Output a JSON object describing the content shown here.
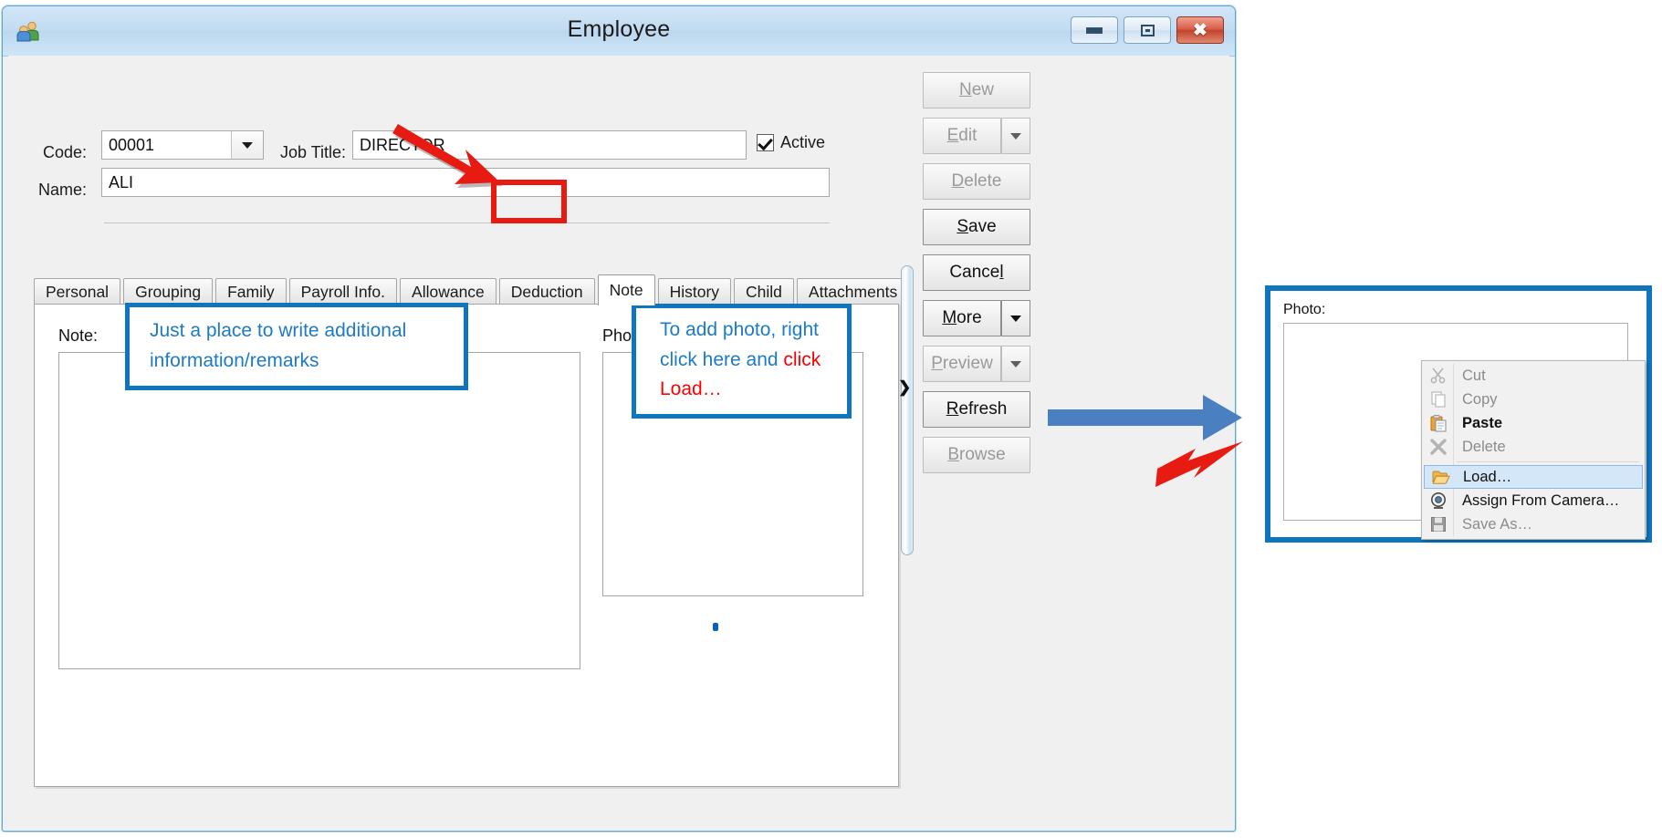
{
  "window": {
    "title": "Employee",
    "icon": "users-icon",
    "controls": {
      "minimize": "minimize-icon",
      "maximize": "maximize-icon",
      "close": "close-icon"
    }
  },
  "form": {
    "code_label": "Code:",
    "code_value": "00001",
    "job_title_label": "Job Title:",
    "job_title_value": "DIRECTOR",
    "name_label": "Name:",
    "name_value": "ALI",
    "active_label": "Active",
    "active_checked": true
  },
  "tabs": [
    {
      "label": "Personal",
      "active": false
    },
    {
      "label": "Grouping",
      "active": false
    },
    {
      "label": "Family",
      "active": false
    },
    {
      "label": "Payroll Info.",
      "active": false
    },
    {
      "label": "Allowance",
      "active": false
    },
    {
      "label": "Deduction",
      "active": false
    },
    {
      "label": "Note",
      "active": true
    },
    {
      "label": "History",
      "active": false
    },
    {
      "label": "Child",
      "active": false
    },
    {
      "label": "Attachments",
      "active": false
    }
  ],
  "note_page": {
    "note_label": "Note:",
    "photo_label": "Photo:"
  },
  "side_buttons": [
    {
      "label": "New",
      "accel": "N",
      "enabled": false,
      "split": false
    },
    {
      "label": "Edit",
      "accel": "E",
      "enabled": false,
      "split": true
    },
    {
      "label": "Delete",
      "accel": "D",
      "enabled": false,
      "split": false
    },
    {
      "label": "Save",
      "accel": "S",
      "enabled": true,
      "split": false
    },
    {
      "label": "Cancel",
      "accel": "l",
      "enabled": true,
      "split": false
    },
    {
      "label": "More",
      "accel": "M",
      "enabled": true,
      "split": true
    },
    {
      "label": "Preview",
      "accel": "P",
      "enabled": false,
      "split": true
    },
    {
      "label": "Refresh",
      "accel": "R",
      "enabled": true,
      "split": false
    },
    {
      "label": "Browse",
      "accel": "B",
      "enabled": false,
      "split": false
    }
  ],
  "callouts": {
    "note": {
      "line1": "Just a place to write additional",
      "line2": "information/remarks"
    },
    "photo": {
      "seg1": "To add photo, right",
      "seg2": "click here and ",
      "seg3_red": "click",
      "seg4_red": "Load…"
    }
  },
  "detail_panel": {
    "photo_label": "Photo:",
    "context_menu": [
      {
        "label": "Cut",
        "icon": "scissors-icon",
        "enabled": false,
        "bold": false,
        "selected": false
      },
      {
        "label": "Copy",
        "icon": "copy-icon",
        "enabled": false,
        "bold": false,
        "selected": false
      },
      {
        "label": "Paste",
        "icon": "paste-icon",
        "enabled": true,
        "bold": true,
        "selected": false
      },
      {
        "label": "Delete",
        "icon": "delete-x-icon",
        "enabled": false,
        "bold": false,
        "selected": false
      },
      {
        "label": "Load…",
        "icon": "folder-open-icon",
        "enabled": true,
        "bold": false,
        "selected": true
      },
      {
        "label": "Assign From Camera…",
        "icon": "webcam-icon",
        "enabled": true,
        "bold": false,
        "selected": false
      },
      {
        "label": "Save As…",
        "icon": "floppy-disk-icon",
        "enabled": false,
        "bold": false,
        "selected": false
      }
    ]
  },
  "colors": {
    "callout_blue": "#0f75bd",
    "callout_text_blue": "#1d7ac4",
    "callout_red": "#ff0000",
    "arrow_red": "#e81b12",
    "arrow_blue": "#4a7fc1",
    "titlebar_blue": "#c3dcf1",
    "selection_blue": "#d3e7f8"
  }
}
